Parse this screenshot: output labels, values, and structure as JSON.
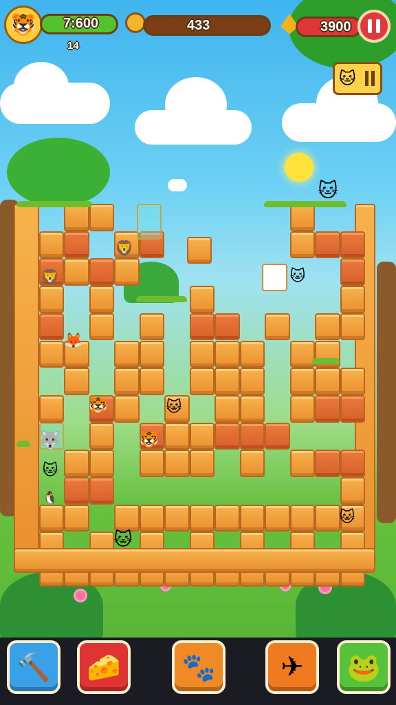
{
  "hud": {
    "timer": "7:600",
    "coins": "433",
    "score": "3900",
    "sub_counter": "14",
    "avatar_icon": "🐯",
    "coin_icon": "coin-icon",
    "gem_icon": "gem-icon",
    "cat_card_icon": "🐱",
    "colors": {
      "timer_bar": "#54c22e",
      "coin_bar": "#7a3d14",
      "score_bar": "#e0363a",
      "pause": "#e23a3a"
    }
  },
  "animals": {
    "top_cat": "🐱",
    "c1": "🦁",
    "c2": "🐱",
    "c3": "🦊",
    "c4": "🐯",
    "c5": "🐺",
    "c6": "🐱",
    "c7": "🐱",
    "c8": "🐱",
    "c9": "🐱",
    "c10": "🐧"
  },
  "toolbar": {
    "items": [
      {
        "name": "hammer-tool",
        "icon": "🔨",
        "color": "#3aa0e8"
      },
      {
        "name": "cheese-tool",
        "icon": "🧀",
        "color": "#e03434"
      },
      {
        "name": "creature-tool",
        "icon": "🐾",
        "color": "#f08a26"
      },
      {
        "name": "plane-tool",
        "icon": "✈",
        "color": "#f07a20"
      },
      {
        "name": "slime-tool",
        "icon": "🐸",
        "color": "#56c23a"
      }
    ]
  }
}
